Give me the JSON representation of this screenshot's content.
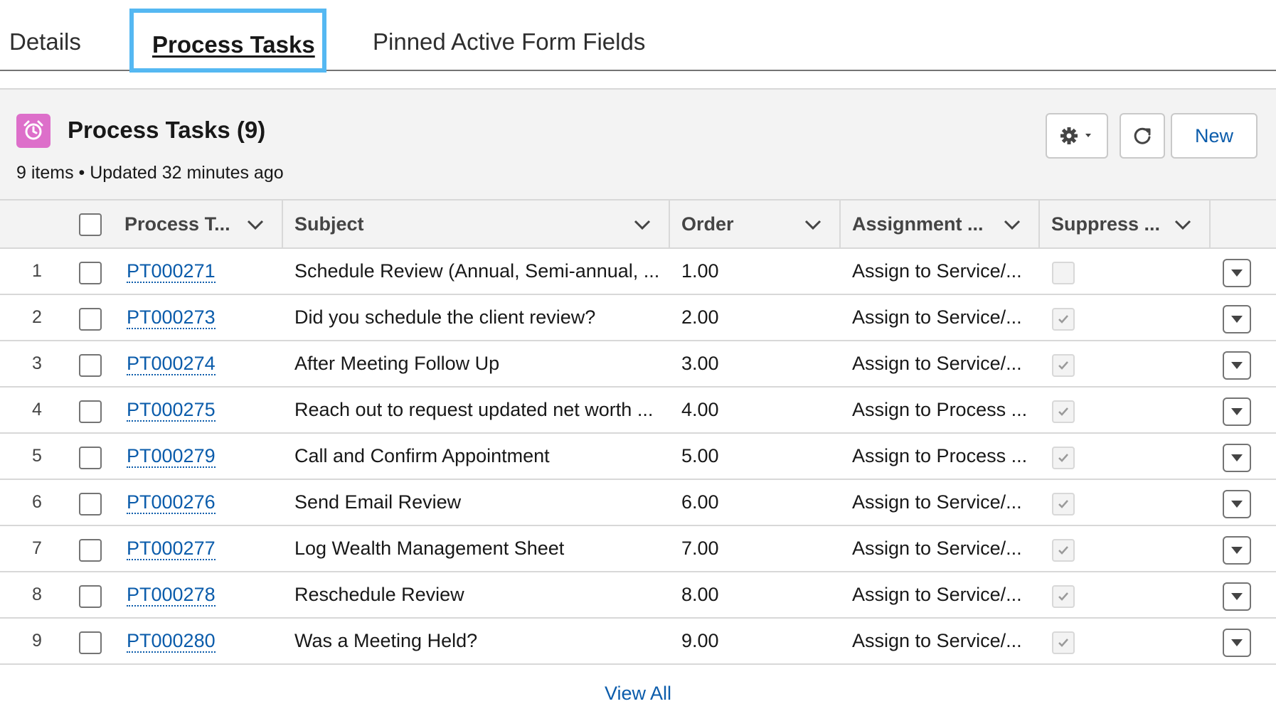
{
  "tabs": [
    {
      "label": "Details"
    },
    {
      "label": "Process Tasks"
    },
    {
      "label": "Pinned Active Form Fields"
    }
  ],
  "card": {
    "icon": "alarm-clock-icon",
    "title": "Process Tasks (9)",
    "meta": "9 items • Updated 32 minutes ago",
    "new_label": "New"
  },
  "columns": [
    {
      "label": "Process T..."
    },
    {
      "label": "Subject"
    },
    {
      "label": "Order"
    },
    {
      "label": "Assignment ..."
    },
    {
      "label": "Suppress ..."
    }
  ],
  "rows": [
    {
      "num": "1",
      "id": "PT000271",
      "subject": "Schedule Review (Annual, Semi-annual, ...",
      "order": "1.00",
      "assignment": "Assign to Service/...",
      "suppress": false
    },
    {
      "num": "2",
      "id": "PT000273",
      "subject": "Did you schedule the client review?",
      "order": "2.00",
      "assignment": "Assign to Service/...",
      "suppress": true
    },
    {
      "num": "3",
      "id": "PT000274",
      "subject": "After Meeting Follow Up",
      "order": "3.00",
      "assignment": "Assign to Service/...",
      "suppress": true
    },
    {
      "num": "4",
      "id": "PT000275",
      "subject": "Reach out to request updated net worth ...",
      "order": "4.00",
      "assignment": "Assign to Process ...",
      "suppress": true
    },
    {
      "num": "5",
      "id": "PT000279",
      "subject": "Call and Confirm Appointment",
      "order": "5.00",
      "assignment": "Assign to Process ...",
      "suppress": true
    },
    {
      "num": "6",
      "id": "PT000276",
      "subject": "Send Email Review",
      "order": "6.00",
      "assignment": "Assign to Service/...",
      "suppress": true
    },
    {
      "num": "7",
      "id": "PT000277",
      "subject": "Log Wealth Management Sheet",
      "order": "7.00",
      "assignment": "Assign to Service/...",
      "suppress": true
    },
    {
      "num": "8",
      "id": "PT000278",
      "subject": "Reschedule Review",
      "order": "8.00",
      "assignment": "Assign to Service/...",
      "suppress": true
    },
    {
      "num": "9",
      "id": "PT000280",
      "subject": "Was a Meeting Held?",
      "order": "9.00",
      "assignment": "Assign to Service/...",
      "suppress": true
    }
  ],
  "footer": {
    "view_all": "View All"
  },
  "colors": {
    "link": "#0b5cab",
    "active_tab_outline": "#55b8f2",
    "icon_bg": "#dd6fca"
  }
}
